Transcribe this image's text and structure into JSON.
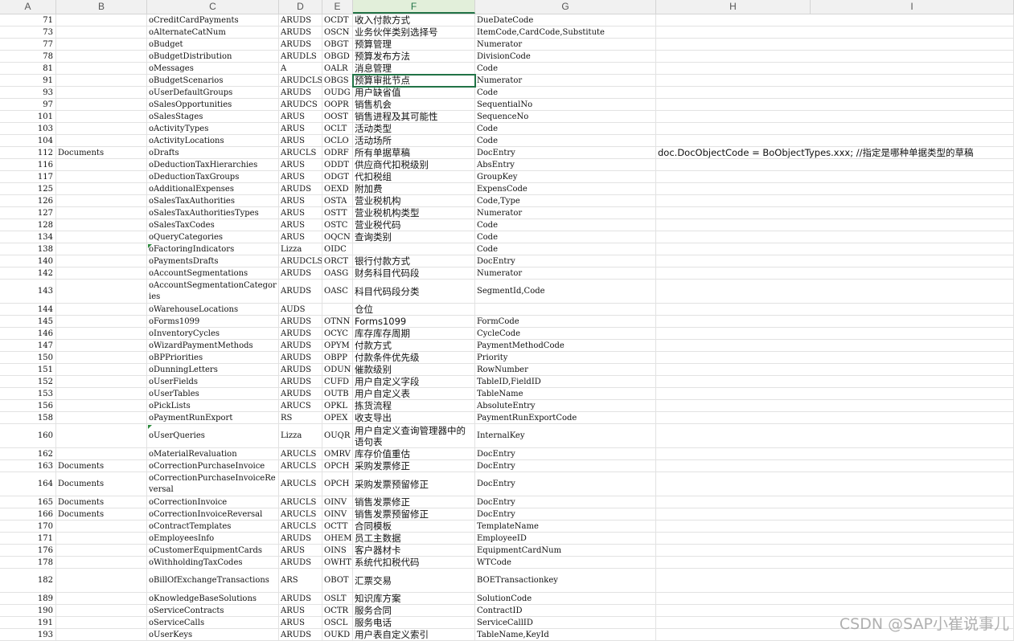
{
  "columns": [
    "A",
    "B",
    "C",
    "D",
    "E",
    "F",
    "G",
    "H",
    "I"
  ],
  "active_column": "F",
  "rows": [
    {
      "a": "71",
      "b": "",
      "c": "oCreditCardPayments",
      "d": "ARUDS",
      "e": "OCDT",
      "f": "收入付款方式",
      "g": "DueDateCode",
      "h": ""
    },
    {
      "a": "73",
      "b": "",
      "c": "oAlternateCatNum",
      "d": "ARUDS",
      "e": "OSCN",
      "f": "业务伙伴类别选择号",
      "g": "ItemCode,CardCode,Substitute",
      "h": ""
    },
    {
      "a": "77",
      "b": "",
      "c": "oBudget",
      "d": "ARUDS",
      "e": "OBGT",
      "f": "预算管理",
      "g": "Numerator",
      "h": ""
    },
    {
      "a": "78",
      "b": "",
      "c": "oBudgetDistribution",
      "d": "ARUDLS",
      "e": "OBGD",
      "f": "预算发布方法",
      "g": "DivisionCode",
      "h": ""
    },
    {
      "a": "81",
      "b": "",
      "c": "oMessages",
      "d": "A",
      "e": "OALR",
      "f": "消息管理",
      "g": "Code",
      "h": ""
    },
    {
      "a": "91",
      "b": "",
      "c": "oBudgetScenarios",
      "d": "ARUDCLS",
      "e": "OBGS",
      "f": "预算审批节点",
      "g": "Numerator",
      "h": ""
    },
    {
      "a": "93",
      "b": "",
      "c": "oUserDefaultGroups",
      "d": "ARUDS",
      "e": "OUDG",
      "f": "用户缺省值",
      "g": "Code",
      "h": ""
    },
    {
      "a": "97",
      "b": "",
      "c": "oSalesOpportunities",
      "d": "ARUDCS",
      "e": "OOPR",
      "f": "销售机会",
      "g": "SequentialNo",
      "h": ""
    },
    {
      "a": "101",
      "b": "",
      "c": "oSalesStages",
      "d": "ARUS",
      "e": "OOST",
      "f": "销售进程及其可能性",
      "g": "SequenceNo",
      "h": ""
    },
    {
      "a": "103",
      "b": "",
      "c": "oActivityTypes",
      "d": "ARUS",
      "e": "OCLT",
      "f": "活动类型",
      "g": "Code",
      "h": ""
    },
    {
      "a": "104",
      "b": "",
      "c": "oActivityLocations",
      "d": "ARUS",
      "e": "OCLO",
      "f": "活动场所",
      "g": "Code",
      "h": ""
    },
    {
      "a": "112",
      "b": "Documents",
      "c": "oDrafts",
      "d": "ARUCLS",
      "e": "ODRF",
      "f": "所有单据草稿",
      "g": "DocEntry",
      "h": "doc.DocObjectCode = BoObjectTypes.xxx;  //指定是哪种单据类型的草稿"
    },
    {
      "a": "116",
      "b": "",
      "c": "oDeductionTaxHierarchies",
      "d": "ARUS",
      "e": "ODDT",
      "f": "供应商代扣税级别",
      "g": "AbsEntry",
      "h": ""
    },
    {
      "a": "117",
      "b": "",
      "c": "oDeductionTaxGroups",
      "d": "ARUS",
      "e": "ODGT",
      "f": "代扣税组",
      "g": "GroupKey",
      "h": ""
    },
    {
      "a": "125",
      "b": "",
      "c": "oAdditionalExpenses",
      "d": "ARUDS",
      "e": "OEXD",
      "f": "附加费",
      "g": "ExpensCode",
      "h": ""
    },
    {
      "a": "126",
      "b": "",
      "c": "oSalesTaxAuthorities",
      "d": "ARUS",
      "e": "OSTA",
      "f": "营业税机构",
      "g": "Code,Type",
      "h": ""
    },
    {
      "a": "127",
      "b": "",
      "c": "oSalesTaxAuthoritiesTypes",
      "d": "ARUS",
      "e": "OSTT",
      "f": "营业税机构类型",
      "g": "Numerator",
      "h": ""
    },
    {
      "a": "128",
      "b": "",
      "c": "oSalesTaxCodes",
      "d": "ARUS",
      "e": "OSTC",
      "f": "营业税代码",
      "g": "Code",
      "h": ""
    },
    {
      "a": "134",
      "b": "",
      "c": "oQueryCategories",
      "d": "ARUS",
      "e": "OQCN",
      "f": "查询类别",
      "g": "Code",
      "h": ""
    },
    {
      "a": "138",
      "b": "",
      "c": "oFactoringIndicators",
      "d": "Lizza",
      "e": "OIDC",
      "f": "",
      "g": "Code",
      "h": ""
    },
    {
      "a": "140",
      "b": "",
      "c": "oPaymentsDrafts",
      "d": "ARUDCLS",
      "e": "ORCT",
      "f": "银行付款方式",
      "g": "DocEntry",
      "h": ""
    },
    {
      "a": "142",
      "b": "",
      "c": "oAccountSegmentations",
      "d": "ARUDS",
      "e": "OASG",
      "f": "财务科目代码段",
      "g": "Numerator",
      "h": ""
    },
    {
      "a": "143",
      "b": "",
      "c": "oAccountSegmentationCategories",
      "d": "ARUDS",
      "e": "OASC",
      "f": "科目代码段分类",
      "g": "SegmentId,Code",
      "h": ""
    },
    {
      "a": "144",
      "b": "",
      "c": "oWarehouseLocations",
      "d": "AUDS",
      "e": "",
      "f": "仓位",
      "g": "",
      "h": ""
    },
    {
      "a": "145",
      "b": "",
      "c": "oForms1099",
      "d": "ARUDS",
      "e": "OTNN",
      "f": "Forms1099",
      "g": "FormCode",
      "h": ""
    },
    {
      "a": "146",
      "b": "",
      "c": "oInventoryCycles",
      "d": "ARUDS",
      "e": "OCYC",
      "f": "库存库存周期",
      "g": "CycleCode",
      "h": ""
    },
    {
      "a": "147",
      "b": "",
      "c": "oWizardPaymentMethods",
      "d": "ARUDS",
      "e": "OPYM",
      "f": "付款方式",
      "g": "PaymentMethodCode",
      "h": ""
    },
    {
      "a": "150",
      "b": "",
      "c": "oBPPriorities",
      "d": "ARUDS",
      "e": "OBPP",
      "f": "付款条件优先级",
      "g": "Priority",
      "h": ""
    },
    {
      "a": "151",
      "b": "",
      "c": "oDunningLetters",
      "d": "ARUDS",
      "e": "ODUN",
      "f": "催款级别",
      "g": "RowNumber",
      "h": ""
    },
    {
      "a": "152",
      "b": "",
      "c": "oUserFields",
      "d": "ARUDS",
      "e": "CUFD",
      "f": "用户自定义字段",
      "g": "TableID,FieldID",
      "h": ""
    },
    {
      "a": "153",
      "b": "",
      "c": "oUserTables",
      "d": "ARUDS",
      "e": "OUTB",
      "f": "用户自定义表",
      "g": "TableName",
      "h": ""
    },
    {
      "a": "156",
      "b": "",
      "c": "oPickLists",
      "d": "ARUCS",
      "e": "OPKL",
      "f": "拣货流程",
      "g": "AbsoluteEntry",
      "h": ""
    },
    {
      "a": "158",
      "b": "",
      "c": "oPaymentRunExport",
      "d": "RS",
      "e": "OPEX",
      "f": "收支导出",
      "g": "PaymentRunExportCode",
      "h": ""
    },
    {
      "a": "160",
      "b": "",
      "c": "oUserQueries",
      "d": "Lizza",
      "e": "OUQR",
      "f": "用户自定义查询管理器中的语句表",
      "g": "InternalKey",
      "h": ""
    },
    {
      "a": "162",
      "b": "",
      "c": "oMaterialRevaluation",
      "d": "ARUCLS",
      "e": "OMRV",
      "f": "库存价值重估",
      "g": "DocEntry",
      "h": ""
    },
    {
      "a": "163",
      "b": "Documents",
      "c": "oCorrectionPurchaseInvoice",
      "d": "ARUCLS",
      "e": "OPCH",
      "f": "采购发票修正",
      "g": "DocEntry",
      "h": ""
    },
    {
      "a": "164",
      "b": "Documents",
      "c": "oCorrectionPurchaseInvoiceReversal",
      "d": "ARUCLS",
      "e": "OPCH",
      "f": "采购发票预留修正",
      "g": "DocEntry",
      "h": ""
    },
    {
      "a": "165",
      "b": "Documents",
      "c": "oCorrectionInvoice",
      "d": "ARUCLS",
      "e": "OINV",
      "f": "销售发票修正",
      "g": "DocEntry",
      "h": ""
    },
    {
      "a": "166",
      "b": "Documents",
      "c": "oCorrectionInvoiceReversal",
      "d": "ARUCLS",
      "e": "OINV",
      "f": "销售发票预留修正",
      "g": "DocEntry",
      "h": ""
    },
    {
      "a": "170",
      "b": "",
      "c": "oContractTemplates",
      "d": "ARUCLS",
      "e": "OCTT",
      "f": "合同模板",
      "g": "TemplateName",
      "h": ""
    },
    {
      "a": "171",
      "b": "",
      "c": "oEmployeesInfo",
      "d": "ARUDS",
      "e": "OHEM",
      "f": "员工主数据",
      "g": "EmployeeID",
      "h": ""
    },
    {
      "a": "176",
      "b": "",
      "c": "oCustomerEquipmentCards",
      "d": "ARUS",
      "e": "OINS",
      "f": "客户器材卡",
      "g": "EquipmentCardNum",
      "h": ""
    },
    {
      "a": "178",
      "b": "",
      "c": "oWithholdingTaxCodes",
      "d": "ARUDS",
      "e": "OWHT",
      "f": "系统代扣税代码",
      "g": "WTCode",
      "h": ""
    },
    {
      "a": "182",
      "b": "",
      "c": "oBillOfExchangeTransactions",
      "d": "ARS",
      "e": "OBOT",
      "f": "汇票交易",
      "g": "BOETransactionkey",
      "h": ""
    },
    {
      "a": "189",
      "b": "",
      "c": "oKnowledgeBaseSolutions",
      "d": "ARUDS",
      "e": "OSLT",
      "f": "知识库方案",
      "g": "SolutionCode",
      "h": ""
    },
    {
      "a": "190",
      "b": "",
      "c": "oServiceContracts",
      "d": "ARUS",
      "e": "OCTR",
      "f": "服务合同",
      "g": "ContractID",
      "h": ""
    },
    {
      "a": "191",
      "b": "",
      "c": "oServiceCalls",
      "d": "ARUS",
      "e": "OSCL",
      "f": "服务电话",
      "g": "ServiceCallID",
      "h": ""
    },
    {
      "a": "193",
      "b": "",
      "c": "oUserKeys",
      "d": "ARUDS",
      "e": "OUKD",
      "f": "用户表自定义索引",
      "g": "TableName,KeyId",
      "h": ""
    }
  ],
  "watermark": "CSDN @SAP小崔说事儿",
  "colors": {
    "accent": "#217346",
    "grid": "#e2e2e2",
    "header_bg": "#f1f1f1"
  }
}
